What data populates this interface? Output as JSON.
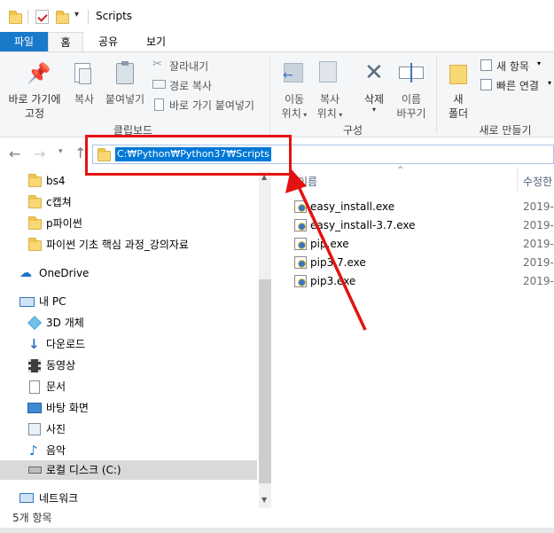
{
  "window": {
    "title": "Scripts"
  },
  "ribbon_tabs": [
    "파일",
    "홈",
    "공유",
    "보기"
  ],
  "clipboard": {
    "pin_label_1": "바로 가기에",
    "pin_label_2": "고정",
    "copy_label": "복사",
    "paste_label": "붙여넣기",
    "cut_label": "잘라내기",
    "copy_path_label": "경로 복사",
    "paste_shortcut_label": "바로 가기 붙여넣기",
    "group_label": "클립보드"
  },
  "organize": {
    "move_to_1": "이동",
    "move_to_2": "위치",
    "copy_to_1": "복사",
    "copy_to_2": "위치",
    "delete_label": "삭제",
    "rename_1": "이름",
    "rename_2": "바꾸기",
    "group_label": "구성"
  },
  "new": {
    "new_folder_1": "새",
    "new_folder_2": "폴더",
    "new_item_label": "새 항목",
    "easy_access_label": "빠른 연결",
    "group_label": "새로 만들기"
  },
  "address": {
    "path": "C:₩Python₩Python37₩Scripts"
  },
  "nav": {
    "quick_folders": [
      "bs4",
      "c캡쳐",
      "p파이썬",
      "파이썬 기초 핵심 과정_강의자료"
    ],
    "onedrive": "OneDrive",
    "this_pc": "내 PC",
    "pc_items": [
      "3D 개체",
      "다운로드",
      "동영상",
      "문서",
      "바탕 화면",
      "사진",
      "음악",
      "로컬 디스크 (C:)"
    ],
    "network": "네트워크"
  },
  "columns": {
    "name": "이름",
    "modified": "수정한"
  },
  "files": [
    {
      "name": "easy_install.exe",
      "date": "2019-0"
    },
    {
      "name": "easy_install-3.7.exe",
      "date": "2019-0"
    },
    {
      "name": "pip.exe",
      "date": "2019-0"
    },
    {
      "name": "pip3.7.exe",
      "date": "2019-0"
    },
    {
      "name": "pip3.exe",
      "date": "2019-0"
    }
  ],
  "status": {
    "count": "5개 항목"
  },
  "colors": {
    "accent": "#1979ca",
    "annotation": "#e31212",
    "selection": "#0078d7"
  }
}
